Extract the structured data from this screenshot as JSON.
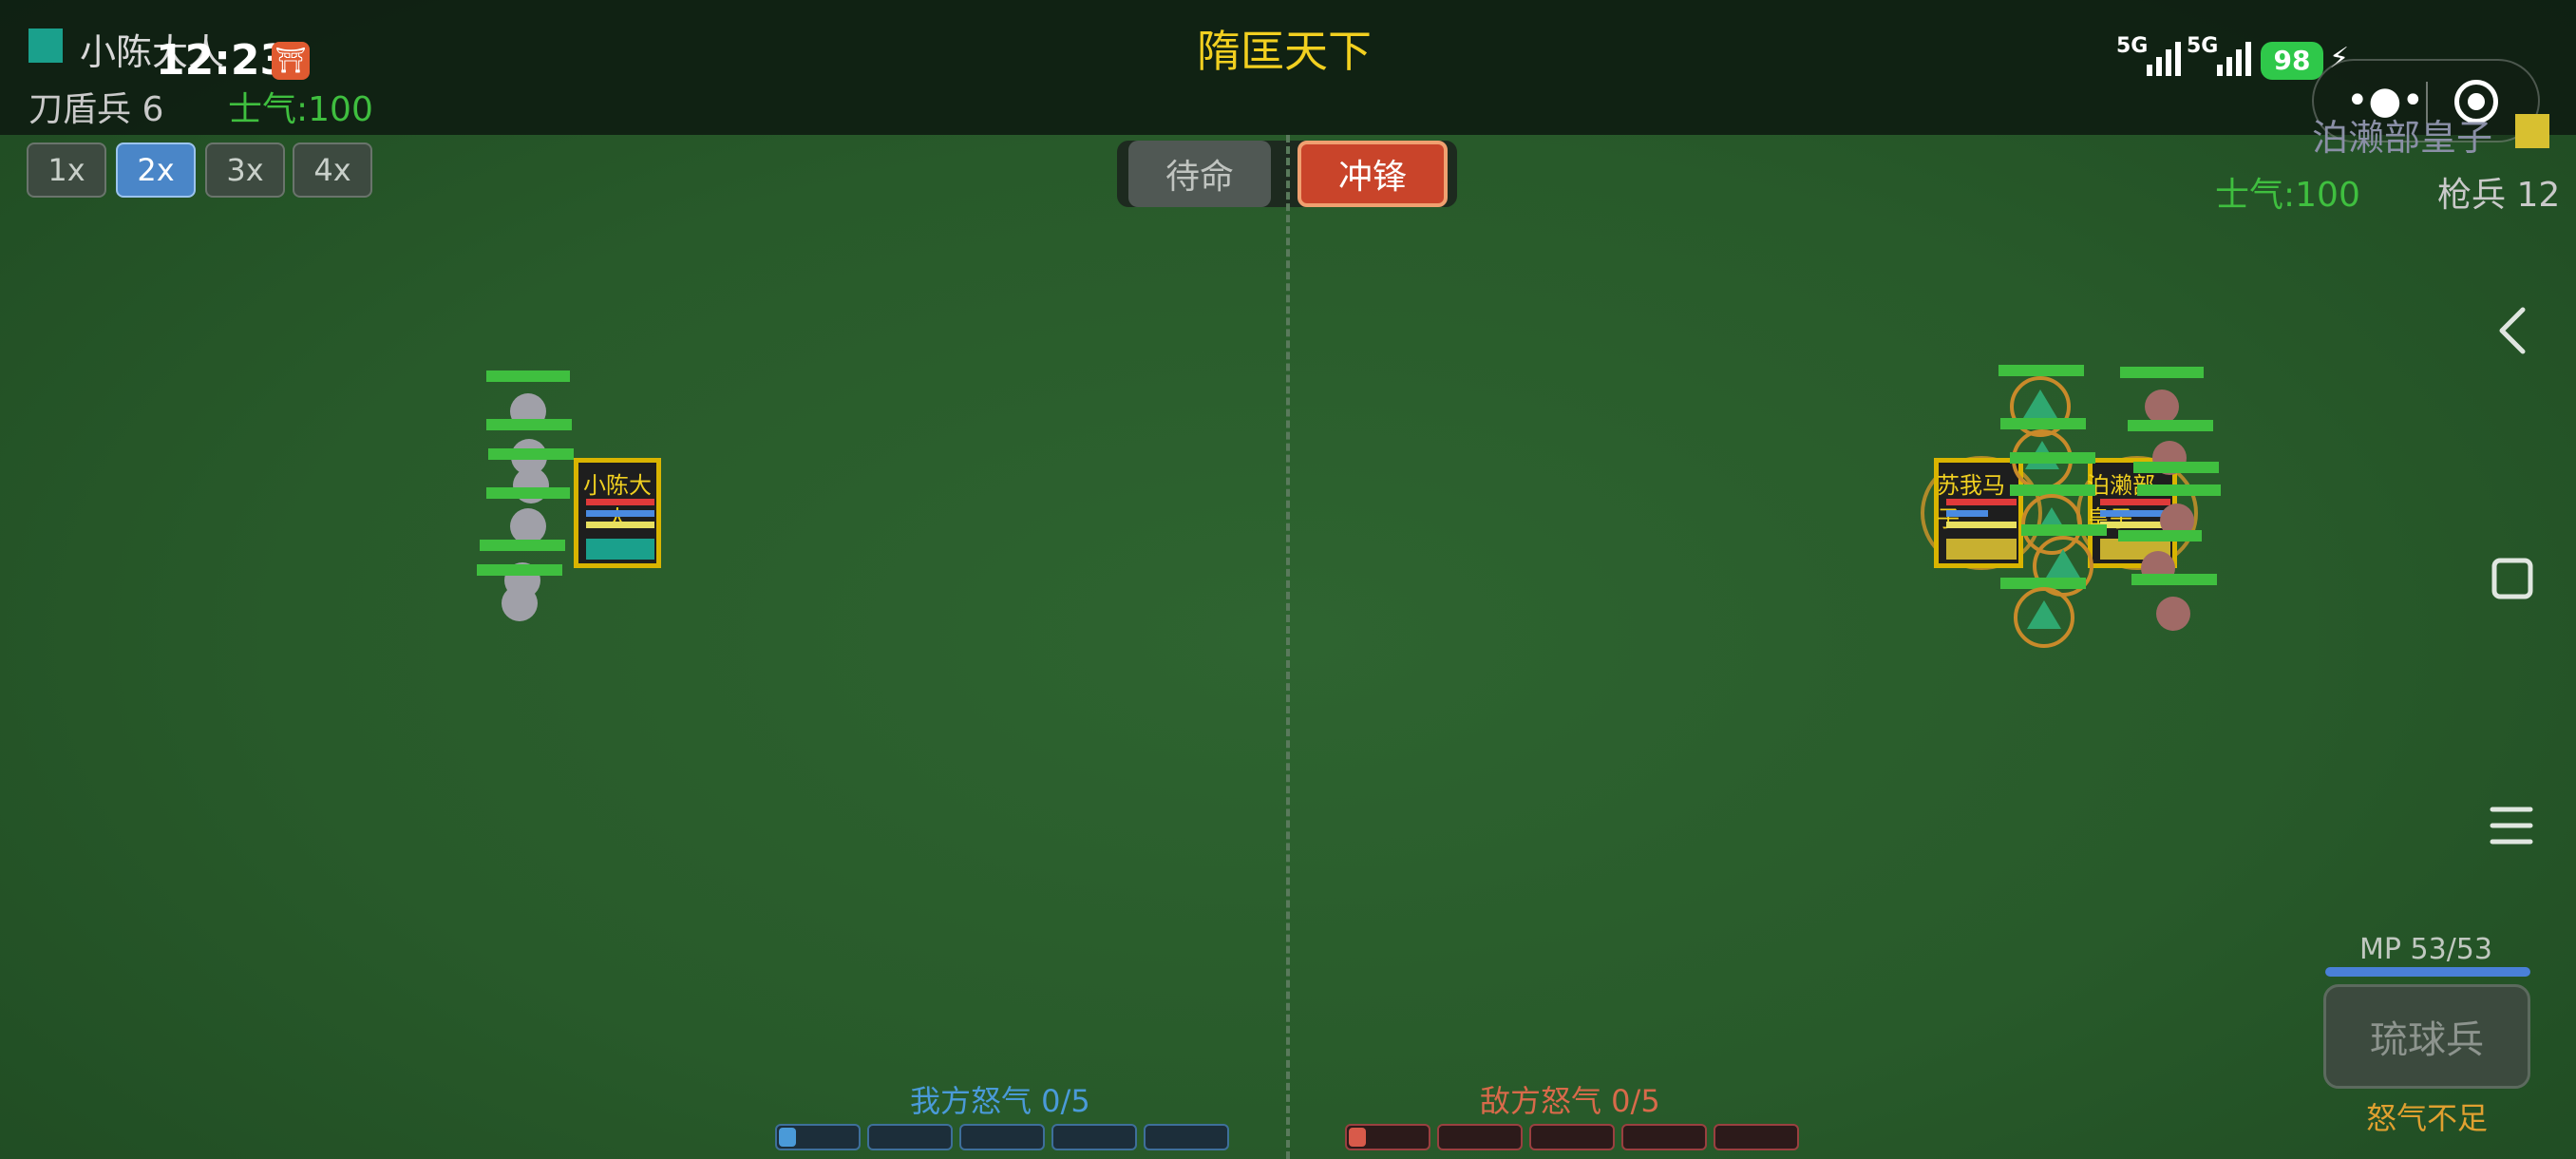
{
  "status_bar": {
    "time": "12:23",
    "network_1": "5G",
    "network_2": "5G",
    "battery": "98"
  },
  "header": {
    "title": "隋匡天下"
  },
  "player": {
    "name": "小陈大人",
    "unit_type": "刀盾兵 6",
    "morale": "士气:100",
    "color": "#1aa08c"
  },
  "enemy": {
    "name": "泊濑部皇子",
    "unit_type": "枪兵 12",
    "morale": "士气:100",
    "color": "#d8c030"
  },
  "speed": {
    "options": [
      "1x",
      "2x",
      "3x",
      "4x"
    ],
    "selected": "2x"
  },
  "modes": {
    "standby": "待命",
    "charge": "冲锋",
    "active": "冲锋"
  },
  "battlefield": {
    "ally_commander_label": "小陈大人",
    "enemy_commander_labels": [
      "苏我马子",
      "泊濑部皇子"
    ]
  },
  "rage": {
    "ally_label": "我方怒气 0/5",
    "enemy_label": "敌方怒气 0/5",
    "ally_value": 0,
    "enemy_value": 0,
    "max": 5
  },
  "skill": {
    "mp_label": "MP 53/53",
    "mp_fraction": 1.0,
    "button_label": "琉球兵",
    "status": "怒气不足"
  },
  "colors": {
    "title_gold": "#f2d020",
    "morale_green": "#3fbf3f",
    "ally_blue": "#4a9ad8",
    "enemy_red": "#d86a4a",
    "status_orange": "#e0a030"
  },
  "nav": {
    "back_icon": "back-icon",
    "home_icon": "home-icon",
    "menu_icon": "menu-icon"
  }
}
